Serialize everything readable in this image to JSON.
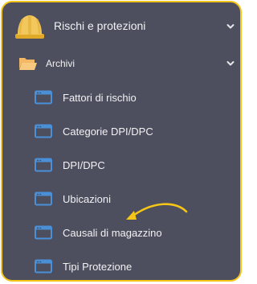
{
  "menu": {
    "section_label": "Rischi e protezioni",
    "folder_label": "Archivi",
    "items": [
      {
        "label": "Fattori di rischio"
      },
      {
        "label": "Categorie DPI/DPC"
      },
      {
        "label": "DPI/DPC"
      },
      {
        "label": "Ubicazioni"
      },
      {
        "label": "Causali di magazzino"
      },
      {
        "label": "Tipi Protezione"
      }
    ]
  },
  "colors": {
    "panel_bg": "#4d4e5e",
    "border": "#f5c518",
    "accent_yellow": "#f5c518",
    "folder_icon": "#f7c87d",
    "window_icon": "#4a90d9",
    "text": "#f2f2f4"
  },
  "icons": {
    "section": "hard-hat-icon",
    "folder": "open-folder-icon",
    "item": "window-icon",
    "expand": "chevron-down-icon",
    "annotation": "curved-arrow-icon"
  }
}
